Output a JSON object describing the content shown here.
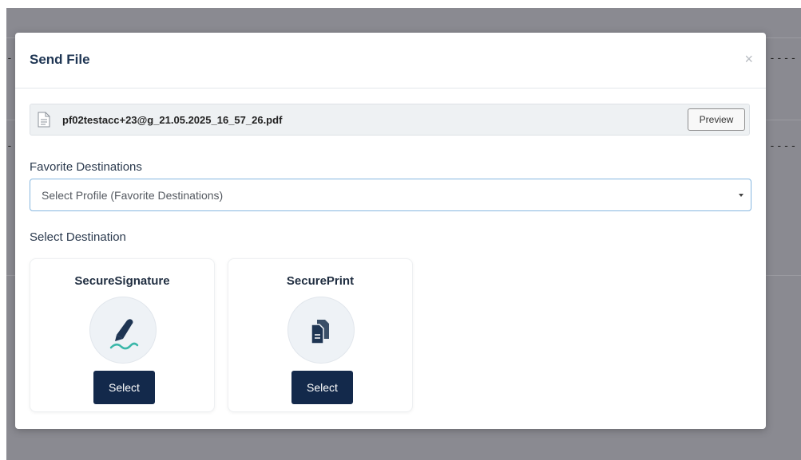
{
  "modal": {
    "title": "Send File",
    "close_glyph": "×"
  },
  "file": {
    "name": "pf02testacc+23@g_21.05.2025_16_57_26.pdf",
    "icon": "document-icon",
    "preview_label": "Preview"
  },
  "favorites": {
    "label": "Favorite Destinations",
    "placeholder": "Select Profile (Favorite Destinations)"
  },
  "destinations": {
    "label": "Select Destination",
    "items": [
      {
        "title": "SecureSignature",
        "icon": "signature-pen-icon",
        "button": "Select"
      },
      {
        "title": "SecurePrint",
        "icon": "print-documents-icon",
        "button": "Select"
      }
    ]
  },
  "colors": {
    "primary": "#13294b",
    "title": "#1e3553",
    "select_border": "#86b7e0",
    "signature_accent": "#3ab7a9",
    "backdrop": "#8a8a91"
  }
}
